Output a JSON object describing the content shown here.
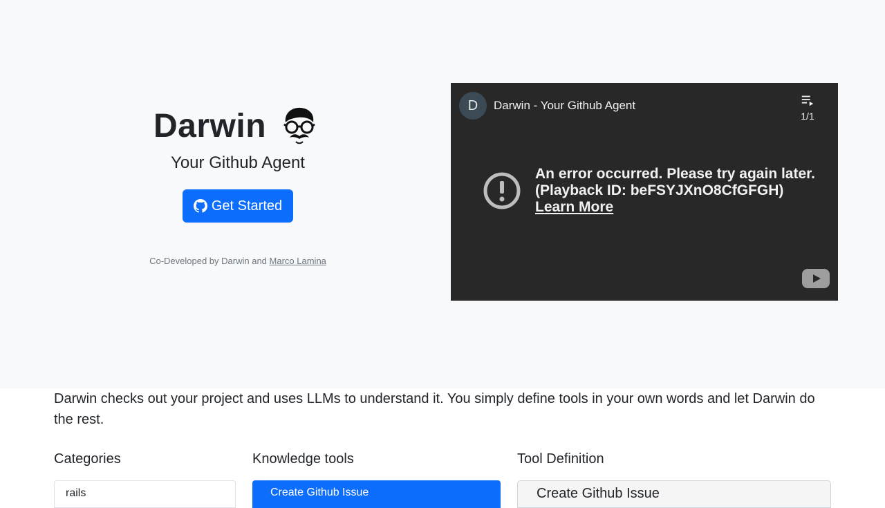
{
  "hero": {
    "title": "Darwin",
    "subtitle": "Your Github Agent",
    "cta_label": "Get Started",
    "credit_prefix": "Co-Developed by Darwin and ",
    "credit_link": "Marco Lamina"
  },
  "video": {
    "channel_initial": "D",
    "title": "Darwin - Your Github Agent",
    "playlist_count": "1/1",
    "error_line1": "An error occurred. Please try again later.",
    "error_line2": "(Playback ID: beFSYJXnO8CfGFGH)",
    "learn_more": "Learn More"
  },
  "description": "Darwin checks out your project and uses LLMs to understand it. You simply define tools in your own words and let Darwin do the rest.",
  "sections": {
    "categories": {
      "heading": "Categories",
      "items": [
        "rails"
      ]
    },
    "knowledge_tools": {
      "heading": "Knowledge tools",
      "items": [
        "Create Github Issue"
      ]
    },
    "tool_definition": {
      "heading": "Tool Definition",
      "name_value": "Create Github Issue"
    }
  },
  "colors": {
    "primary": "#0d6efd",
    "hero_bg": "#f8f9fa",
    "video_bg": "#282828"
  },
  "icons": [
    "mascot-icon",
    "github-icon",
    "playlist-icon",
    "error-icon",
    "youtube-logo-icon"
  ]
}
